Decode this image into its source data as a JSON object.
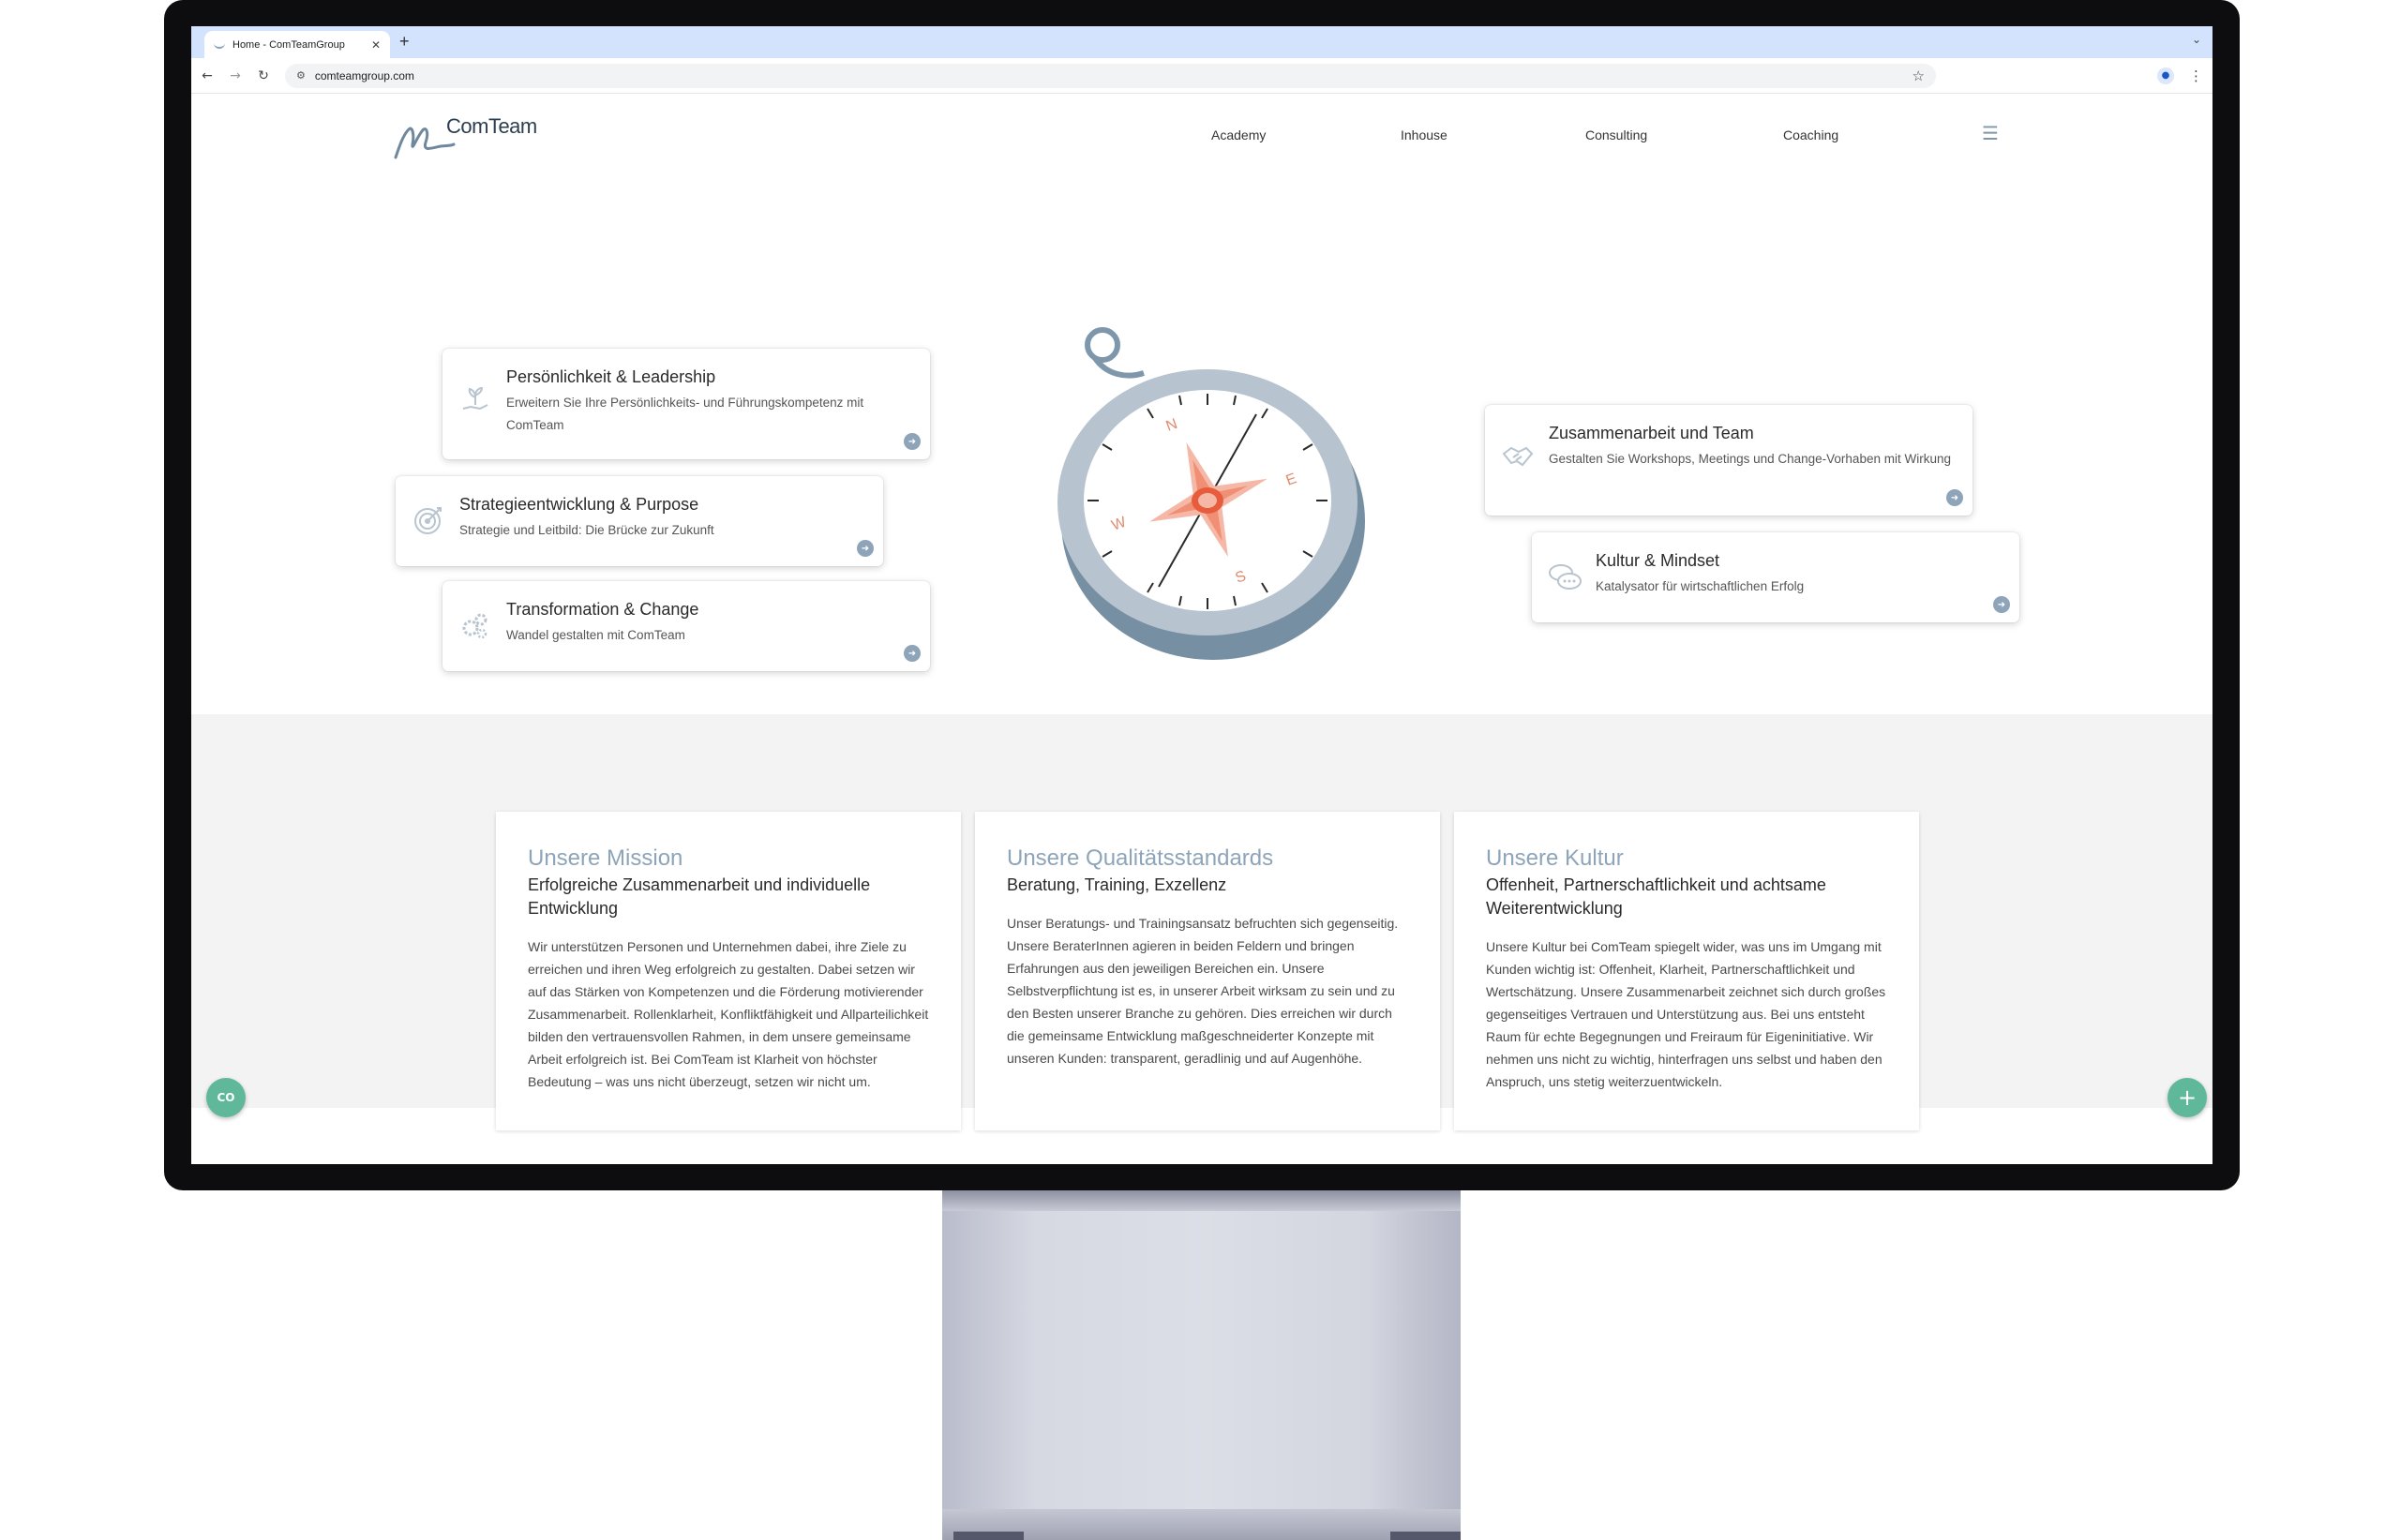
{
  "browser": {
    "tab_title": "Home - ComTeamGroup",
    "tab_close": "✕",
    "new_tab": "+",
    "url": "comteamgroup.com"
  },
  "site": {
    "logo_text": "ComTeam",
    "nav": [
      "Academy",
      "Inhouse",
      "Consulting",
      "Coaching"
    ],
    "menu_icon": "☰"
  },
  "compass": {
    "n": "N",
    "e": "E",
    "s": "S",
    "w": "W"
  },
  "topics": [
    {
      "title": "Persönlichkeit & Leadership",
      "desc": "Erweitern Sie Ihre Persönlichkeits- und Führungskompetenz mit ComTeam",
      "icon": "plant-hand-icon"
    },
    {
      "title": "Strategieentwicklung & Purpose",
      "desc": "Strategie und Leitbild: Die Brücke zur Zukunft",
      "icon": "target-icon"
    },
    {
      "title": "Transformation & Change",
      "desc": "Wandel gestalten mit ComTeam",
      "icon": "gears-icon"
    },
    {
      "title": "Zusammenarbeit und Team",
      "desc": "Gestalten Sie Workshops, Meetings und Change-Vorhaben mit Wirkung",
      "icon": "handshake-icon"
    },
    {
      "title": "Kultur & Mindset",
      "desc": "Katalysator für wirtschaftlichen Erfolg",
      "icon": "chat-bubbles-icon"
    }
  ],
  "values": [
    {
      "heading": "Unsere Mission",
      "subheading": "Erfolgreiche Zusammenarbeit und individuelle Entwicklung",
      "body": "Wir unterstützen Personen und Unternehmen dabei, ihre Ziele zu erreichen und ihren Weg erfolgreich zu gestalten. Dabei setzen wir auf das Stärken von Kompetenzen und die Förderung motivierender Zusammenarbeit. Rollenklarheit, Konfliktfähigkeit und Allparteilichkeit bilden den vertrauensvollen Rahmen, in dem unsere gemeinsame Arbeit erfolgreich ist. Bei ComTeam ist Klarheit von höchster Bedeutung – was uns nicht überzeugt, setzen wir nicht um."
    },
    {
      "heading": "Unsere Qualitätsstandards",
      "subheading": "Beratung, Training, Exzellenz",
      "body": "Unser Beratungs- und Trainingsansatz befruchten sich gegenseitig. Unsere BeraterInnen agieren in beiden Feldern und bringen Erfahrungen aus den jeweiligen Bereichen ein. Unsere Selbstverpflichtung ist es, in unserer Arbeit wirksam zu sein und zu den Besten unserer Branche zu gehören. Dies erreichen wir durch die gemeinsame Entwicklung maßgeschneiderter Konzepte mit unseren Kunden: transparent, geradlinig und auf Augenhöhe."
    },
    {
      "heading": "Unsere Kultur",
      "subheading": "Offenheit, Partnerschaftlichkeit und achtsame Weiterentwicklung",
      "body": "Unsere Kultur bei ComTeam spiegelt wider, was uns im Umgang mit Kunden wichtig ist: Offenheit, Klarheit, Partnerschaftlichkeit und Wertschätzung. Unsere Zusammenarbeit zeichnet sich durch großes gegenseitiges Vertrauen und Unterstützung aus. Bei uns entsteht Raum für echte Begegnungen und Freiraum für Eigeninitiative. Wir nehmen uns nicht zu wichtig, hinterfragen uns selbst und haben den Anspruch, uns stetig weiterzuentwickeln."
    }
  ],
  "fabs": {
    "left": "CO",
    "right": "+"
  },
  "colors": {
    "accent": "#8ea4b8",
    "fab": "#5fb89a",
    "compass_needle": "#f2a28c"
  }
}
